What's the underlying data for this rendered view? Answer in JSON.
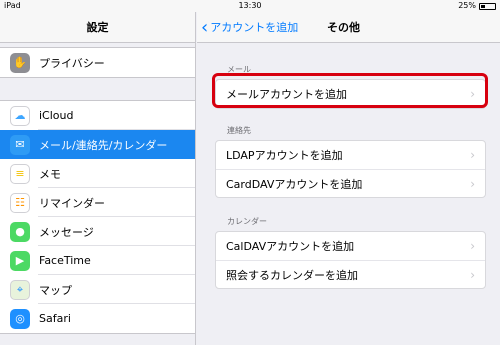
{
  "statusbar": {
    "device": "iPad",
    "time": "13:30",
    "battery": "25%"
  },
  "sidebar": {
    "title": "設定",
    "items_top": [
      {
        "label": "プライバシー",
        "icon": "hand-icon",
        "color": "#8e8e93",
        "glyph": "✋"
      }
    ],
    "items": [
      {
        "label": "iCloud",
        "icon": "icloud-icon",
        "color": "#ffffff",
        "glyph": "☁"
      },
      {
        "label": "メール/連絡先/カレンダー",
        "icon": "mail-icon",
        "color": "#1e90ff",
        "glyph": "✉"
      },
      {
        "label": "メモ",
        "icon": "notes-icon",
        "color": "#ffffff",
        "glyph": "≡"
      },
      {
        "label": "リマインダー",
        "icon": "reminders-icon",
        "color": "#ffffff",
        "glyph": "☷"
      },
      {
        "label": "メッセージ",
        "icon": "messages-icon",
        "color": "#4cd964",
        "glyph": "💬"
      },
      {
        "label": "FaceTime",
        "icon": "facetime-icon",
        "color": "#4cd964",
        "glyph": "▶"
      },
      {
        "label": "マップ",
        "icon": "maps-icon",
        "color": "#ffffff",
        "glyph": "⌖"
      },
      {
        "label": "Safari",
        "icon": "safari-icon",
        "color": "#1e90ff",
        "glyph": "◎"
      }
    ]
  },
  "detail": {
    "back_label": "アカウントを追加",
    "title": "その他",
    "sections": [
      {
        "header": "メール",
        "rows": [
          "メールアカウントを追加"
        ]
      },
      {
        "header": "連絡先",
        "rows": [
          "LDAPアカウントを追加",
          "CardDAVアカウントを追加"
        ]
      },
      {
        "header": "カレンダー",
        "rows": [
          "CalDAVアカウントを追加",
          "照会するカレンダーを追加"
        ]
      }
    ]
  },
  "colors": {
    "accent": "#007aff",
    "selection": "#1b87f0",
    "highlight": "#d7000f"
  }
}
